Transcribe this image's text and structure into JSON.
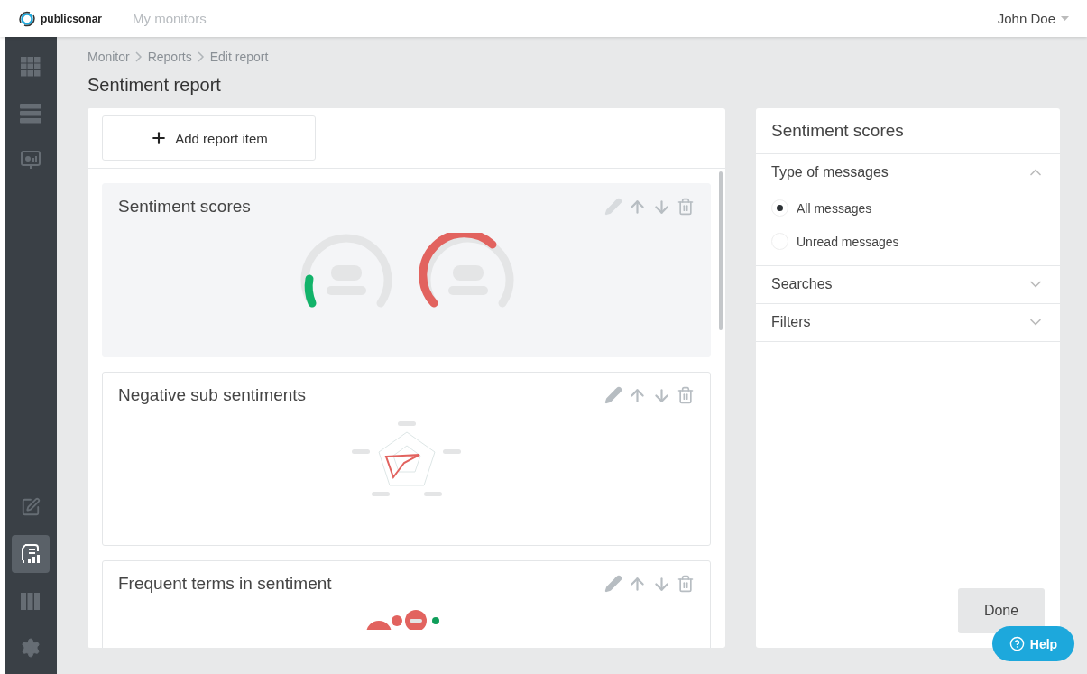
{
  "topbar": {
    "brand": "publicsonar",
    "nav": "My monitors",
    "user": "John Doe"
  },
  "sidebar": {
    "items": [
      {
        "kind": "grid",
        "selected": false
      },
      {
        "kind": "list",
        "selected": false
      },
      {
        "kind": "screen",
        "selected": false
      },
      {
        "kind": "edit",
        "selected": false
      },
      {
        "kind": "report",
        "selected": true
      },
      {
        "kind": "books",
        "selected": false
      },
      {
        "kind": "gear",
        "selected": false
      }
    ]
  },
  "breadcrumb": [
    "Monitor",
    "Reports",
    "Edit report"
  ],
  "title": "Sentiment report",
  "add_button": "Add report item",
  "report_items": [
    {
      "title": "Sentiment scores",
      "selected": true,
      "kind": "gauges"
    },
    {
      "title": "Negative sub sentiments",
      "selected": false,
      "kind": "radar"
    },
    {
      "title": "Frequent terms in sentiment",
      "selected": false,
      "kind": "bubbles"
    }
  ],
  "settings": {
    "title": "Sentiment scores",
    "sections": [
      {
        "label": "Type of messages",
        "expanded": true,
        "options": [
          {
            "label": "All messages",
            "selected": true
          },
          {
            "label": "Unread messages",
            "selected": false
          }
        ]
      },
      {
        "label": "Searches",
        "expanded": false
      },
      {
        "label": "Filters",
        "expanded": false
      }
    ],
    "done_button": "Done"
  },
  "help_button": "Help"
}
